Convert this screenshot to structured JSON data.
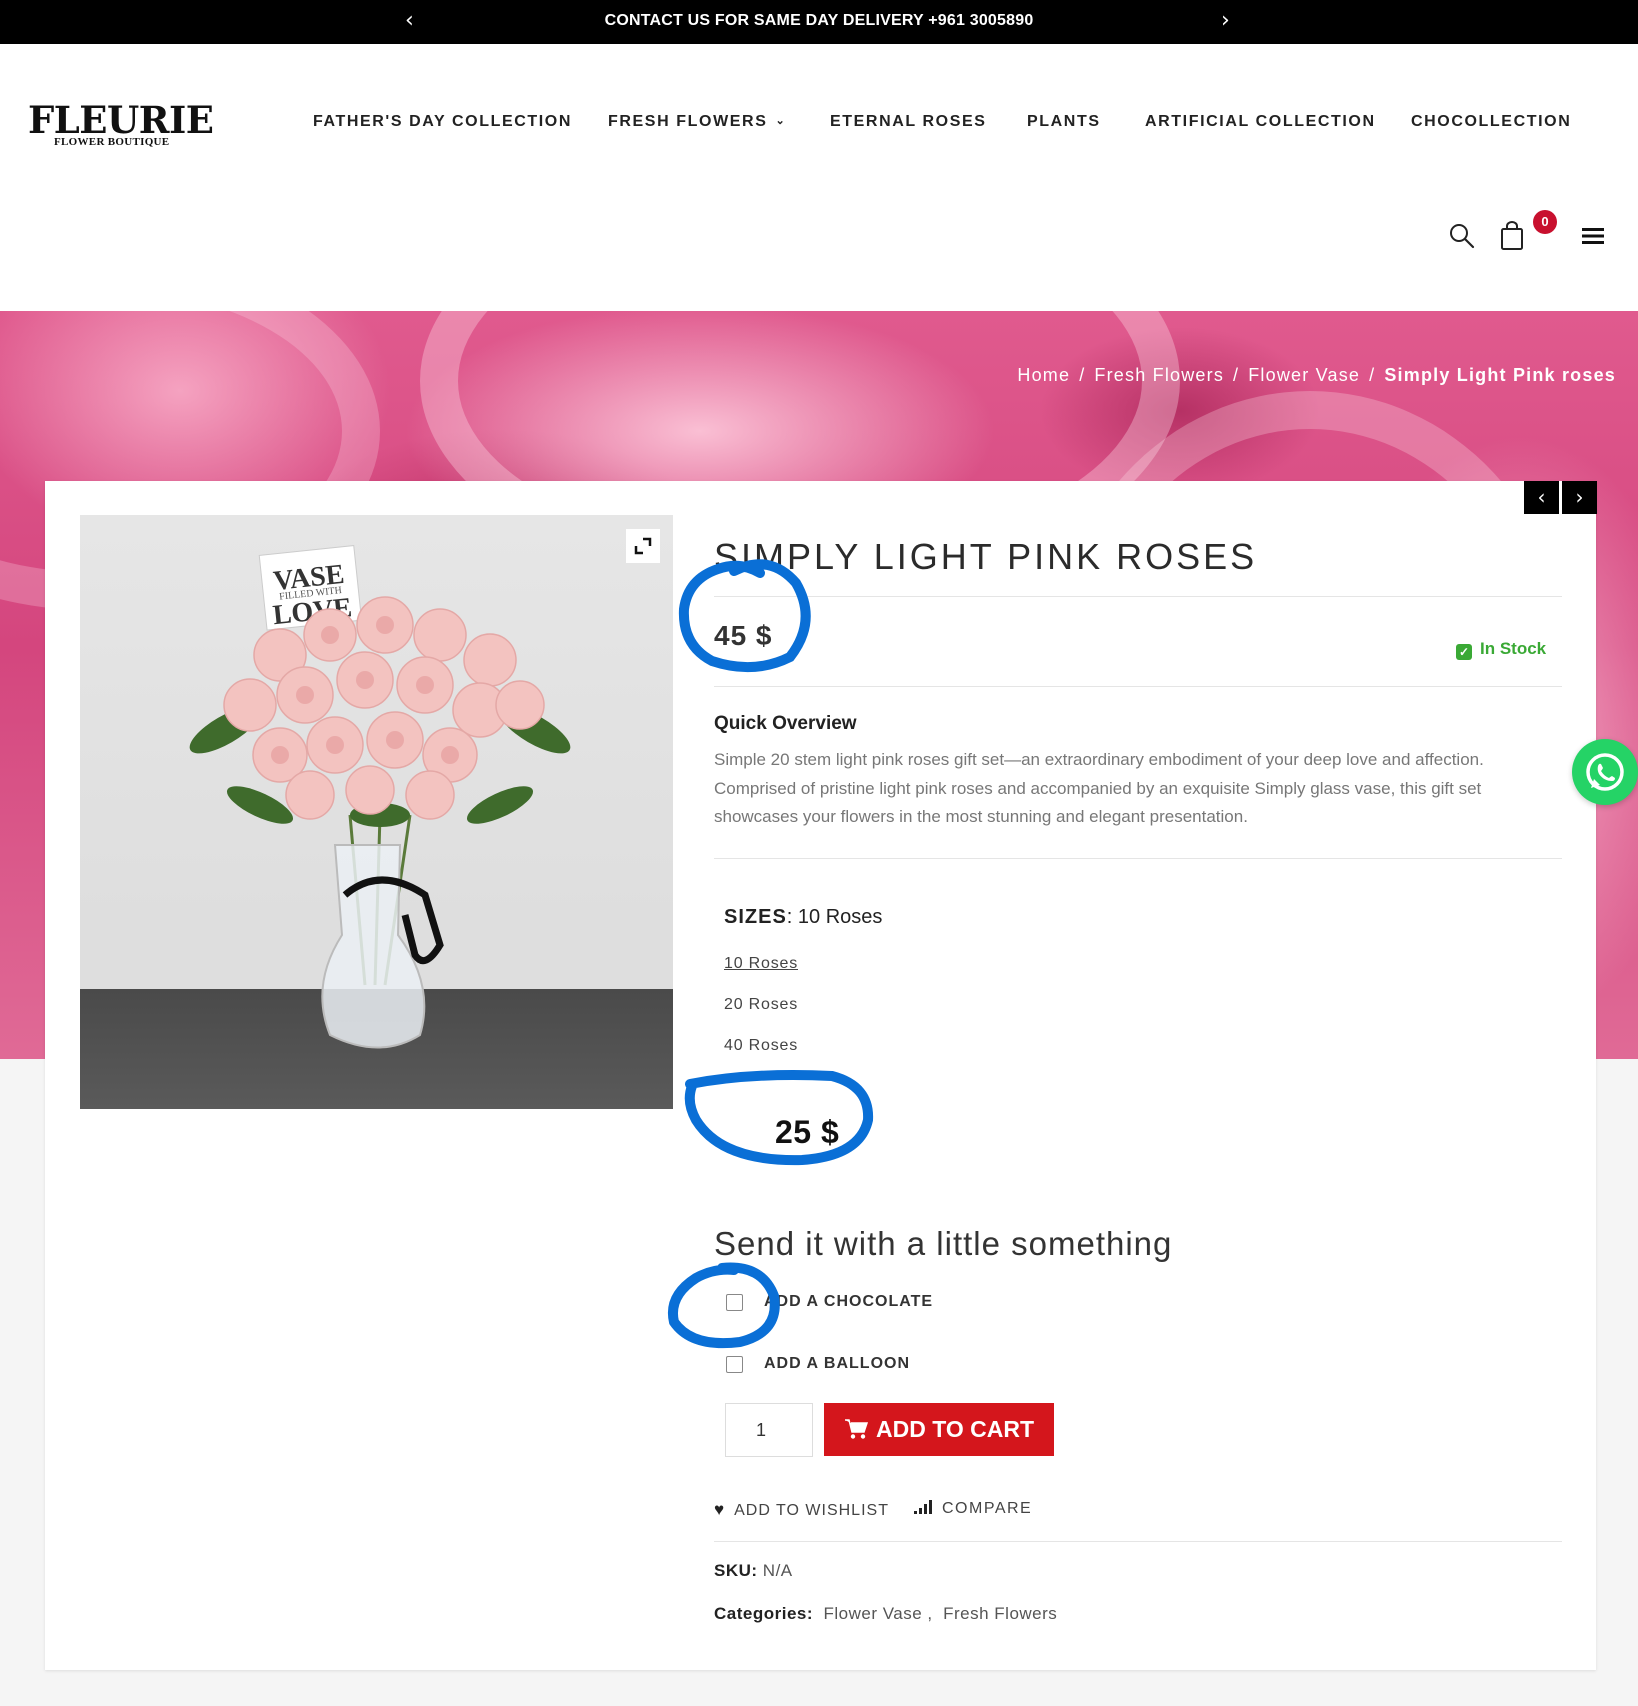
{
  "top_bar": {
    "message": "CONTACT US FOR SAME DAY DELIVERY +961 3005890",
    "prev_arrow": "‹",
    "next_arrow": "›",
    "background": "#000000"
  },
  "logo": {
    "name": "FLEURIE",
    "subtitle": "FLOWER BOUTIQUE"
  },
  "nav": {
    "items": [
      {
        "label": "FATHER'S DAY COLLECTION"
      },
      {
        "label": "FRESH FLOWERS",
        "has_dropdown": true,
        "dropdown_icon": "chevron-down-icon"
      },
      {
        "label": "ETERNAL ROSES"
      },
      {
        "label": "PLANTS"
      },
      {
        "label": "ARTIFICIAL COLLECTION"
      },
      {
        "label": "CHOCOLLECTION"
      }
    ]
  },
  "header_icons": {
    "search": "search-icon",
    "cart": "shopping-bag-icon",
    "menu": "hamburger-menu-icon",
    "cart_count": "0",
    "badge_color": "#c8102e"
  },
  "breadcrumb": {
    "items": [
      "Home",
      "Fresh Flowers",
      "Flower Vase"
    ],
    "separator": "/",
    "current": "Simply Light Pink roses"
  },
  "product": {
    "title": "SIMPLY LIGHT PINK ROSES",
    "price": "45 $",
    "stock_status": "In Stock",
    "stock_color": "#3aa935",
    "overview_title": "Quick Overview",
    "overview_text": "Simple 20 stem light pink roses gift set—an extraordinary embodiment of your deep love and affection. Comprised of pristine light pink roses and accompanied by an exquisite Simply glass vase, this gift set showcases your flowers in the most stunning and elegant presentation.",
    "sizes_label": "SIZES",
    "selected_size": "10 Roses",
    "sizes": [
      "10 Roses",
      "20 Roses",
      "40 Roses"
    ],
    "variation_price": "25 $",
    "addons_title": "Send it with a little something",
    "addons": [
      {
        "label": "ADD A CHOCOLATE",
        "checked": false
      },
      {
        "label": "ADD A BALLOON",
        "checked": false
      }
    ],
    "quantity": "1",
    "add_to_cart_label": "ADD TO CART",
    "add_to_cart_color": "#d4161c",
    "wishlist_label": "ADD TO WISHLIST",
    "compare_label": "COMPARE",
    "sku_label": "SKU:",
    "sku_value": "N/A",
    "categories_label": "Categories:",
    "categories": [
      "Flower Vase",
      "Fresh Flowers"
    ],
    "image_card_text": [
      "VASE",
      "FILLED WITH",
      "LOVE"
    ]
  },
  "product_nav": {
    "prev": "‹",
    "next": "›"
  },
  "floating": {
    "whatsapp": "whatsapp-icon",
    "color": "#25d366"
  },
  "annotation_color": "#0a6fd6"
}
